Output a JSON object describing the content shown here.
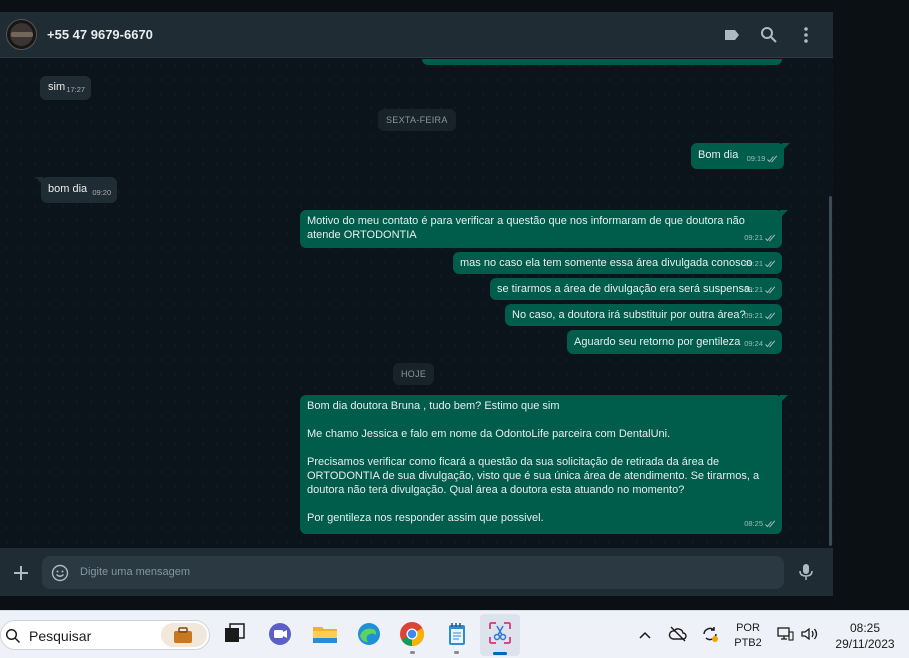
{
  "header": {
    "contact": "+55 47 9679-6670"
  },
  "dates": {
    "sexta": "SEXTA-FEIRA",
    "hoje": "HOJE"
  },
  "messages": [
    {
      "text": "sim",
      "time": "17:27"
    },
    {
      "text": "Bom dia",
      "time": "09:19"
    },
    {
      "text": "bom dia",
      "time": "09:20"
    },
    {
      "text": "Motivo do meu contato é para verificar a questão que nos informaram de que doutora não atende ORTODONTIA",
      "time": "09:21"
    },
    {
      "text": "mas no caso ela tem somente essa área divulgada conosco",
      "time": "09:21"
    },
    {
      "text": "se tirarmos a área de divulgação era será suspensa.",
      "time": "09:21"
    },
    {
      "text": "No caso, a doutora irá substituir por outra área?",
      "time": "09:21"
    },
    {
      "text": "Aguardo seu retorno por gentileza",
      "time": "09:24"
    },
    {
      "text": "Bom dia doutora Bruna , tudo bem? Estimo que sim\n\nMe chamo Jessica e falo em nome da OdontoLife parceira com DentalUni.\n\nPrecisamos verificar como ficará a questão da sua solicitação de retirada da área de ORTODONTIA de sua divulgação, visto que é sua única área de atendimento. Se tirarmos, a doutora não terá divulgação. Qual área a doutora esta atuando no momento?\n\nPor gentileza nos responder assim que possivel.",
      "time": "08:25"
    }
  ],
  "composer": {
    "placeholder": "Digite uma mensagem"
  },
  "taskbar": {
    "search": "Pesquisar",
    "lang1": "POR",
    "lang2": "PTB2",
    "time": "08:25",
    "date": "29/11/2023"
  },
  "colors": {
    "accent": "#005c4b",
    "incoming": "#202c33",
    "background": "#0b141a"
  }
}
